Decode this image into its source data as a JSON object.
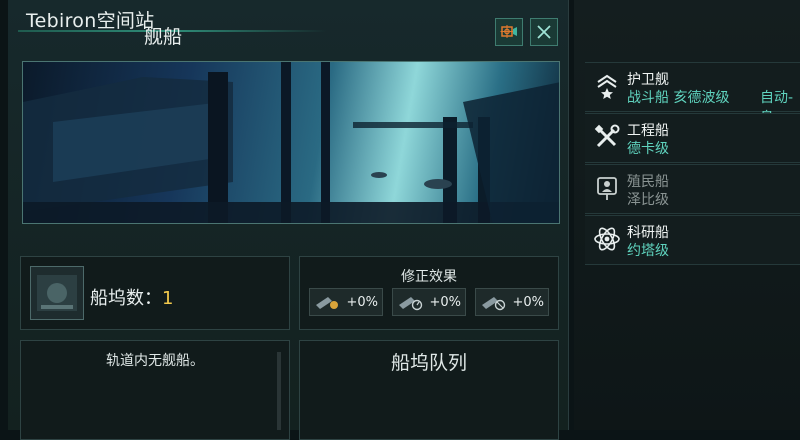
{
  "header": {
    "title": "Tebiron空间站"
  },
  "icons": {
    "camera": "camera-target-icon",
    "close": "close-x-icon"
  },
  "dock": {
    "label": "船坞数：",
    "count": "1"
  },
  "modifiers": {
    "title": "修正效果",
    "items": [
      {
        "value": "+0%",
        "icon": "cost-modifier-icon"
      },
      {
        "value": "+0%",
        "icon": "speed-modifier-icon"
      },
      {
        "value": "+0%",
        "icon": "upkeep-modifier-icon"
      }
    ]
  },
  "orbit": {
    "message": "轨道内无舰船。"
  },
  "queue": {
    "title": "船坞队列"
  },
  "ships_panel": {
    "title": "舰船",
    "ships": [
      {
        "name": "护卫舰",
        "sub": "战斗船 亥德波级",
        "extra": "自动-島",
        "icon": "rank-chevron-star-icon",
        "enabled": true
      },
      {
        "name": "工程船",
        "sub": "德卡级",
        "icon": "tools-icon",
        "enabled": true
      },
      {
        "name": "殖民船",
        "sub": "泽比级",
        "icon": "colony-flag-icon",
        "enabled": false
      },
      {
        "name": "科研船",
        "sub": "约塔级",
        "icon": "atom-icon",
        "enabled": true
      }
    ]
  },
  "colors": {
    "accent": "#5fd3be",
    "count": "#f2c94c",
    "button_orange": "#e07a2e"
  }
}
